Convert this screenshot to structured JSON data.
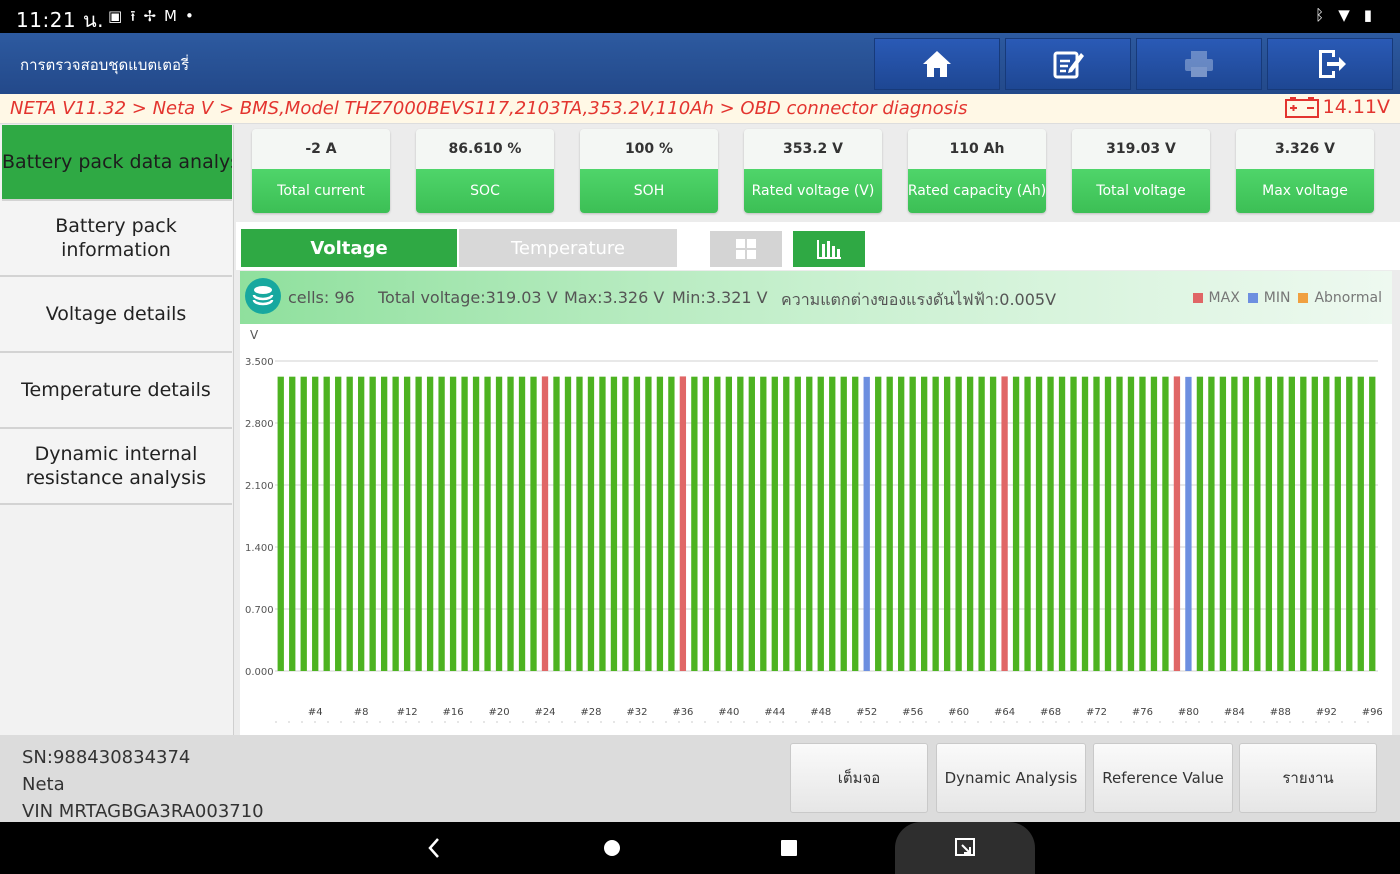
{
  "status_bar": {
    "time": "11:21 น.",
    "left_icons": [
      "gallery-icon",
      "upload-icon",
      "fan-icon",
      "gmail-icon",
      "dot-icon"
    ],
    "right_icons": [
      "bluetooth-icon",
      "wifi-icon",
      "battery-icon"
    ]
  },
  "header": {
    "title": "การตรวจสอบชุดแบตเตอรี่",
    "buttons": [
      "home-icon",
      "edit-icon",
      "print-icon",
      "exit-icon"
    ]
  },
  "breadcrumb": {
    "path": "NETA V11.32 > Neta V  > BMS,Model THZ7000BEVS117,2103TA,353.2V,110Ah > OBD connector diagnosis",
    "battery_voltage": "14.11V"
  },
  "sidebar": {
    "items": [
      {
        "label": "Battery pack data analysis",
        "active": true
      },
      {
        "label": "Battery pack information",
        "active": false
      },
      {
        "label": "Voltage details",
        "active": false
      },
      {
        "label": "Temperature details",
        "active": false
      },
      {
        "label": "Dynamic internal resistance analysis",
        "active": false
      }
    ]
  },
  "cards": [
    {
      "value": "-2 A",
      "label": "Total current"
    },
    {
      "value": "86.610 %",
      "label": "SOC"
    },
    {
      "value": "100 %",
      "label": "SOH"
    },
    {
      "value": "353.2 V",
      "label": "Rated voltage (V)"
    },
    {
      "value": "110 Ah",
      "label": "Rated capacity (Ah)"
    },
    {
      "value": "319.03 V",
      "label": "Total voltage"
    },
    {
      "value": "3.326 V",
      "label": "Max voltage"
    }
  ],
  "tabs": {
    "voltage": "Voltage",
    "temperature": "Temperature"
  },
  "info": {
    "cells": "cells:  96",
    "total_voltage": "Total voltage:319.03 V",
    "max": "Max:3.326 V",
    "min": "Min:3.321 V",
    "diff": "ความแตกต่างของแรงดันไฟฟ้า:0.005V"
  },
  "legend": [
    {
      "label": "MAX",
      "color": "#e06666"
    },
    {
      "label": "MIN",
      "color": "#6d8fe0"
    },
    {
      "label": "Abnormal",
      "color": "#f0a040"
    }
  ],
  "chart_data": {
    "type": "bar",
    "ylabel": "V",
    "ylim": [
      0,
      3.5
    ],
    "yticks": [
      "0.000",
      "0.700",
      "1.400",
      "2.100",
      "2.800",
      "3.500"
    ],
    "xtick_labels": [
      "#4",
      "#8",
      "#12",
      "#16",
      "#20",
      "#24",
      "#28",
      "#32",
      "#36",
      "#40",
      "#44",
      "#48",
      "#52",
      "#56",
      "#60",
      "#64",
      "#68",
      "#72",
      "#76",
      "#80",
      "#84",
      "#88",
      "#92",
      "#96"
    ],
    "cell_count": 96,
    "values": [
      3.323,
      3.323,
      3.323,
      3.323,
      3.323,
      3.323,
      3.323,
      3.323,
      3.323,
      3.323,
      3.323,
      3.323,
      3.323,
      3.323,
      3.323,
      3.323,
      3.323,
      3.323,
      3.323,
      3.323,
      3.323,
      3.323,
      3.323,
      3.326,
      3.323,
      3.323,
      3.323,
      3.323,
      3.323,
      3.323,
      3.323,
      3.323,
      3.323,
      3.323,
      3.323,
      3.326,
      3.323,
      3.323,
      3.323,
      3.323,
      3.323,
      3.323,
      3.323,
      3.323,
      3.323,
      3.323,
      3.323,
      3.323,
      3.323,
      3.323,
      3.323,
      3.321,
      3.323,
      3.323,
      3.323,
      3.323,
      3.323,
      3.323,
      3.323,
      3.323,
      3.323,
      3.323,
      3.323,
      3.326,
      3.323,
      3.323,
      3.323,
      3.323,
      3.323,
      3.323,
      3.323,
      3.323,
      3.323,
      3.323,
      3.323,
      3.323,
      3.323,
      3.323,
      3.326,
      3.321,
      3.323,
      3.323,
      3.323,
      3.323,
      3.323,
      3.323,
      3.323,
      3.323,
      3.323,
      3.323,
      3.323,
      3.323,
      3.323,
      3.323,
      3.323,
      3.323
    ],
    "max_cells": [
      24,
      36,
      64,
      79
    ],
    "min_cells": [
      52,
      80
    ],
    "normal_color": "#4db321"
  },
  "device": {
    "sn": "SN:988430834374",
    "brand": "Neta",
    "vin": "VIN MRTAGBGA3RA003710"
  },
  "actions": [
    "เต็มจอ",
    "Dynamic Analysis",
    "Reference Value",
    "รายงาน"
  ]
}
